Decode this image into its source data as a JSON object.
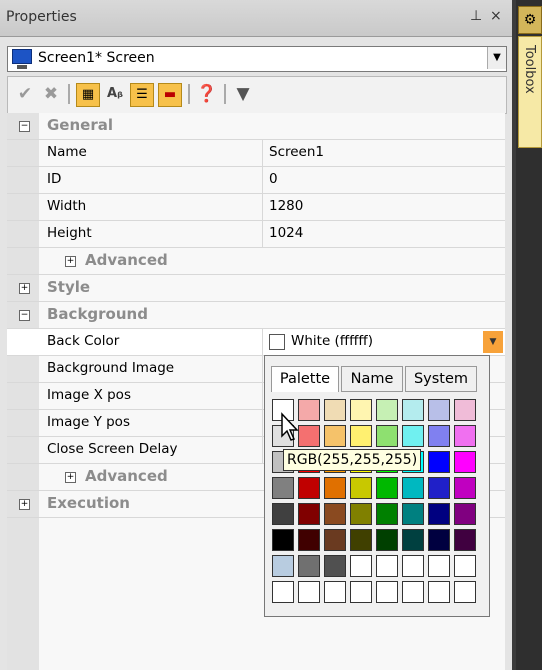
{
  "window": {
    "title": "Properties",
    "pin_glyph": "ᵖ",
    "close_glyph": "×"
  },
  "object_selector": {
    "value": "Screen1* Screen"
  },
  "categories": {
    "general": "General",
    "advanced": "Advanced",
    "style": "Style",
    "background": "Background",
    "execution": "Execution"
  },
  "toggle": {
    "expanded": "−",
    "collapsed": "+"
  },
  "general": [
    {
      "name": "Name",
      "value": "Screen1"
    },
    {
      "name": "ID",
      "value": "0"
    },
    {
      "name": "Width",
      "value": "1280"
    },
    {
      "name": "Height",
      "value": "1024"
    }
  ],
  "background": {
    "back_color": {
      "name": "Back Color",
      "value": "White (ffffff)",
      "swatch": "#ffffff"
    },
    "background_image": "Background Image",
    "image_x": "Image X pos",
    "image_y": "Image Y pos",
    "close_delay": "Close Screen Delay"
  },
  "color_popup": {
    "tabs": [
      "Palette",
      "Name",
      "System"
    ],
    "active_tab": "Palette",
    "tooltip": "RGB(255,255,255)",
    "rows": [
      [
        "#ffffff",
        "#f4a9a9",
        "#f0dcb4",
        "#fff5b0",
        "#c6f0b4",
        "#b4ecee",
        "#b8bfe8",
        "#f0bcd8"
      ],
      [
        "#e0e0e0",
        "#f47070",
        "#f5c26a",
        "#fff070",
        "#8ee070",
        "#70f0f0",
        "#8080f0",
        "#f070f0"
      ],
      [
        "#c0c0c0",
        "#ff0000",
        "#ff9c00",
        "#ffff00",
        "#00ff00",
        "#00ffff",
        "#0000ff",
        "#ff00ff"
      ],
      [
        "#808080",
        "#c00000",
        "#e07000",
        "#c8c800",
        "#00b800",
        "#00b8c0",
        "#2020c8",
        "#c000c0"
      ],
      [
        "#404040",
        "#800000",
        "#8a4a20",
        "#808000",
        "#008000",
        "#008080",
        "#000080",
        "#800080"
      ],
      [
        "#000000",
        "#400000",
        "#6a3a20",
        "#404000",
        "#004000",
        "#004040",
        "#000040",
        "#400040"
      ],
      [
        "#b8cce0",
        "#707070",
        "#505050",
        "#ffffff",
        "#ffffff",
        "#ffffff",
        "#ffffff",
        "#ffffff"
      ],
      [
        "#ffffff",
        "#ffffff",
        "#ffffff",
        "#ffffff",
        "#ffffff",
        "#ffffff",
        "#ffffff",
        "#ffffff"
      ]
    ]
  },
  "toolbox": {
    "label": "Toolbox"
  },
  "colors": {
    "dropdown_accent": "#f7a23a",
    "category_text": "#8c8c8c"
  }
}
